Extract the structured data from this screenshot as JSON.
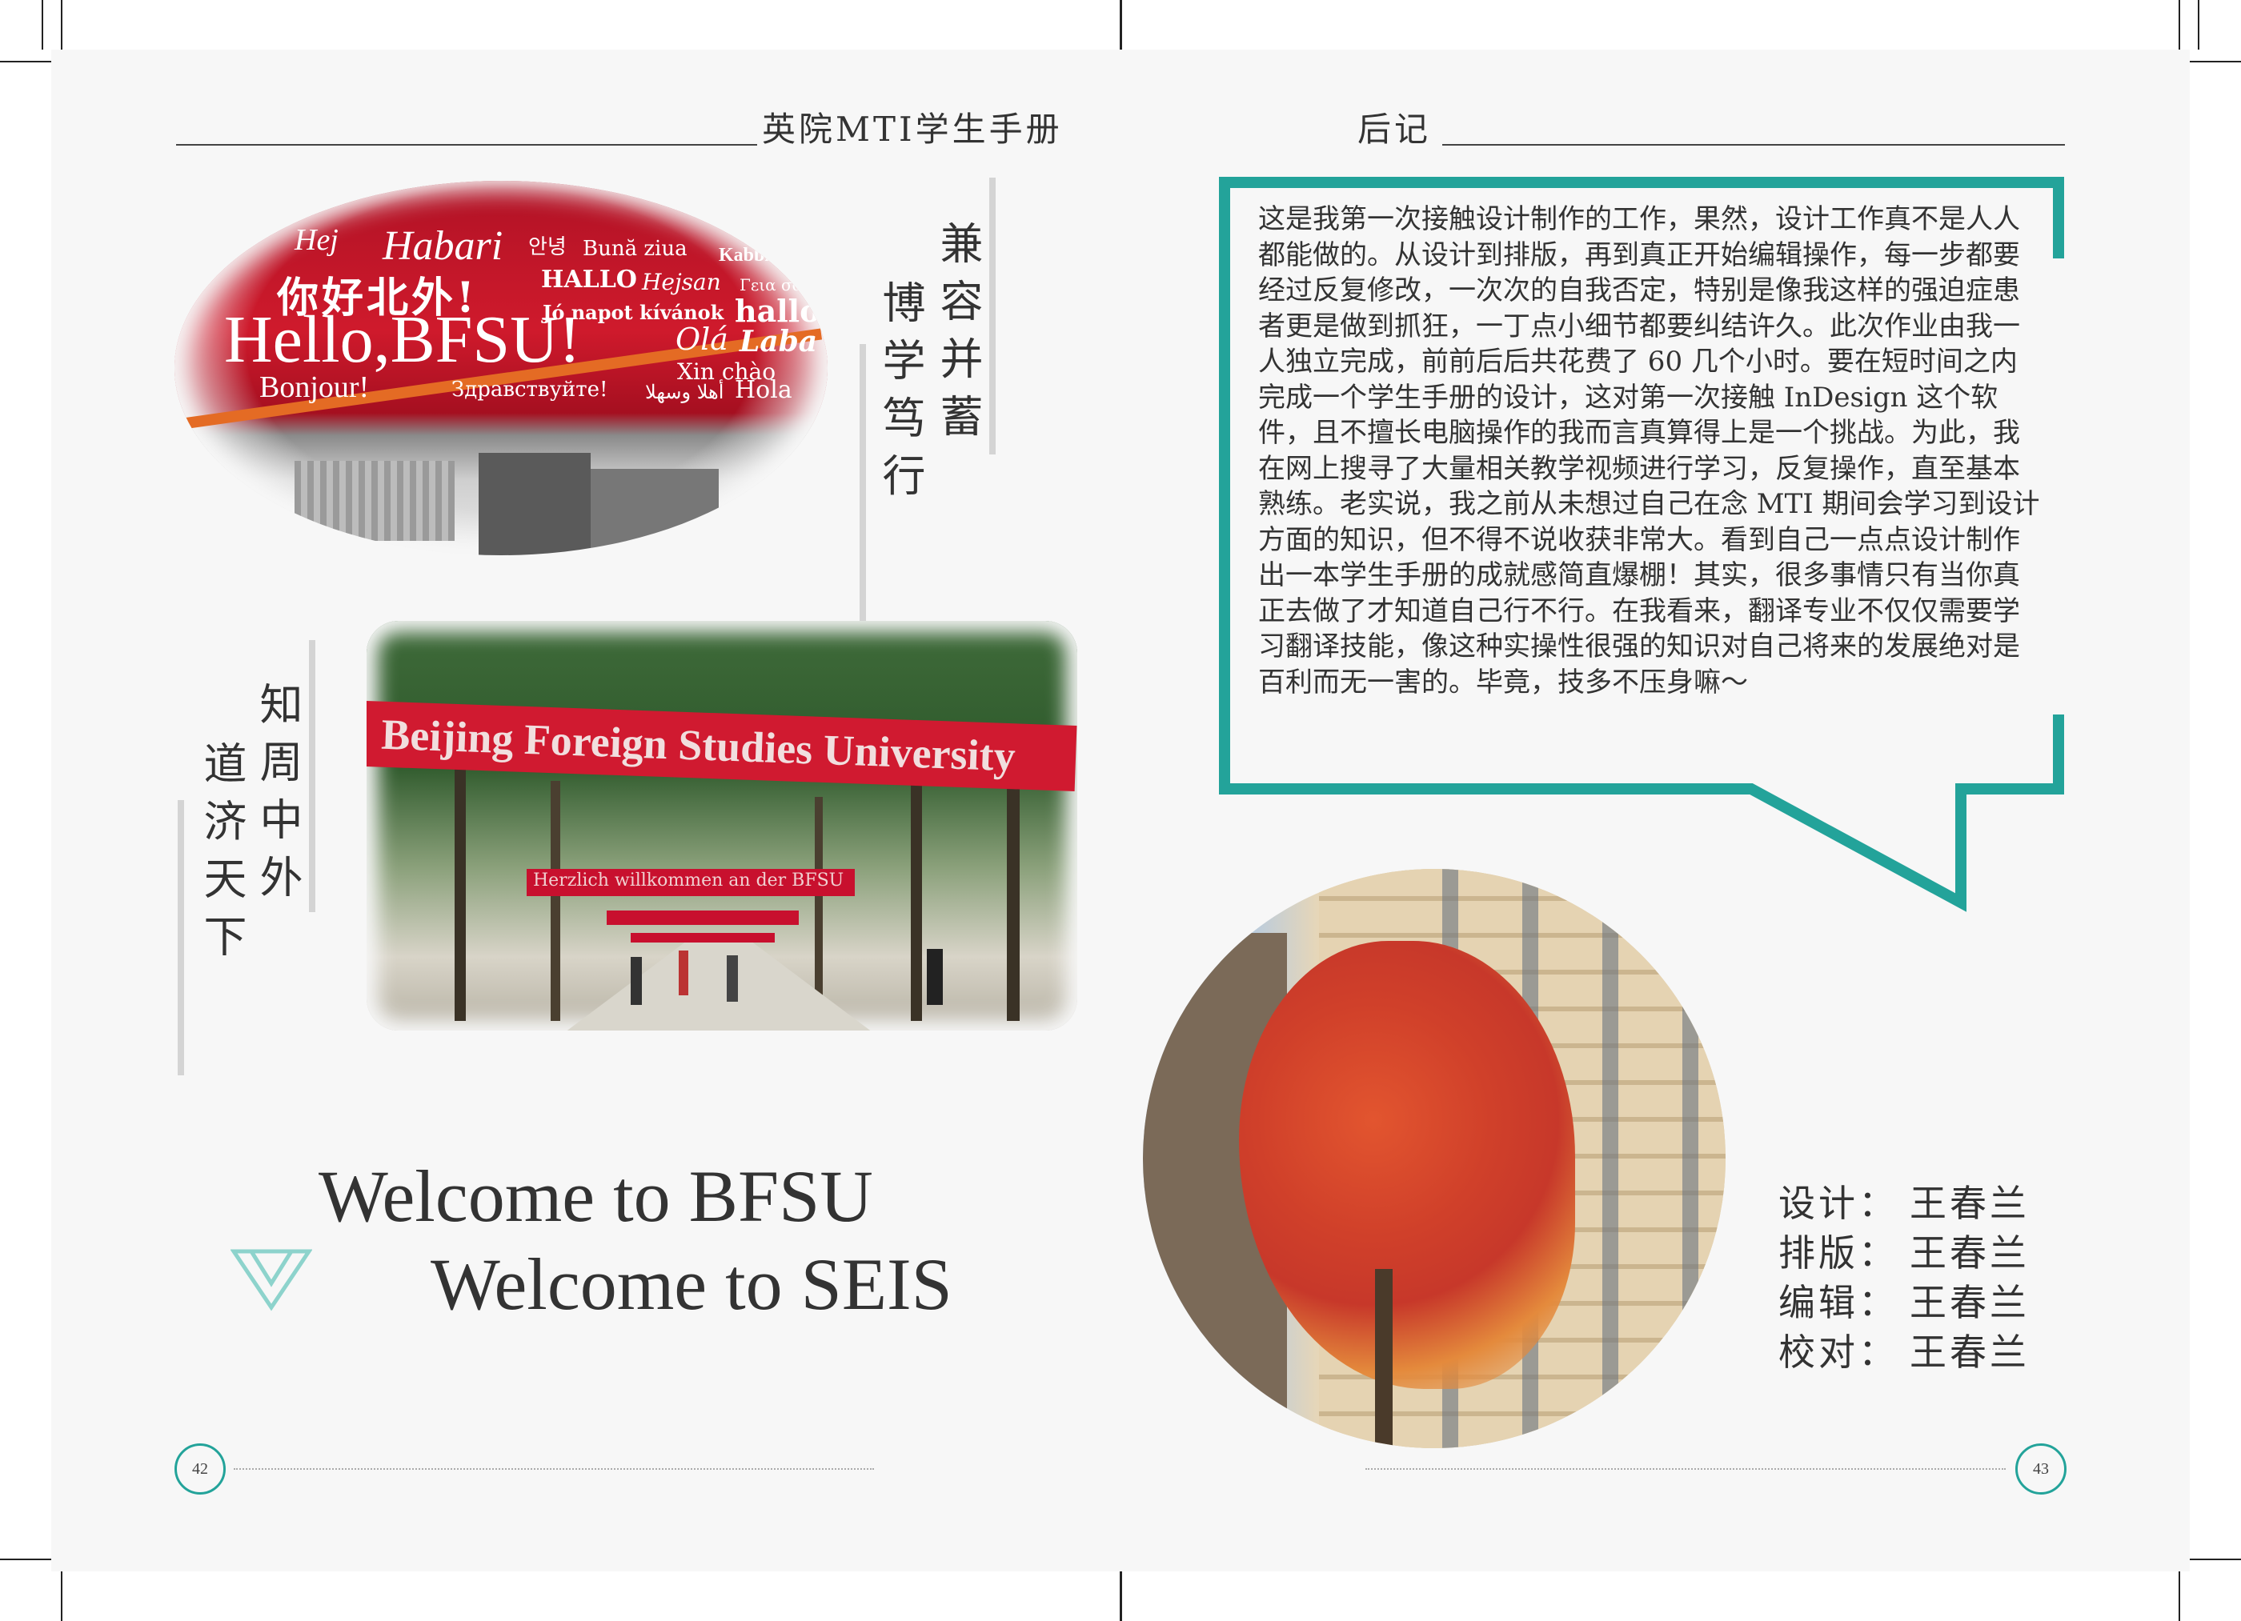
{
  "left_page": {
    "header": "英院MTI学生手册",
    "page_number": "42",
    "motto_1": {
      "col_a": "兼容并蓄",
      "col_b": "博学笃行"
    },
    "motto_2": {
      "col_a": "知周中外",
      "col_b": "道济天下"
    },
    "photo_1": {
      "greetings": [
        "Hej",
        "Habari",
        "안녕",
        "Bună ziua",
        "Kabbieh",
        "你好北外!",
        "HALLO",
        "Hejsan",
        "Γεια σας",
        "Jó napot kívánok",
        "halló",
        "Hello,BFSU!",
        "Olá",
        "Laba",
        "Xin chào",
        "Bonjour!",
        "Здравствуйте!",
        "أهلا وسهلا",
        "Hola"
      ]
    },
    "photo_2": {
      "banner_main": "Beijing Foreign Studies University",
      "banner_small": "Herzlich willkommen an der BFSU"
    },
    "welcome_line_1": "Welcome to BFSU",
    "welcome_line_2": "Welcome to SEIS",
    "triangle_icon": "double-triangle-icon"
  },
  "right_page": {
    "header": "后记",
    "page_number": "43",
    "afterword": "这是我第一次接触设计制作的工作，果然，设计工作真不是人人都能做的。从设计到排版，再到真正开始编辑操作，每一步都要经过反复修改，一次次的自我否定，特别是像我这样的强迫症患者更是做到抓狂，一丁点小细节都要纠结许久。此次作业由我一人独立完成，前前后后共花费了 60 几个小时。要在短时间之内完成一个学生手册的设计，这对第一次接触 InDesign 这个软件，且不擅长电脑操作的我而言真算得上是一个挑战。为此，我在网上搜寻了大量相关教学视频进行学习，反复操作，直至基本熟练。老实说，我之前从未想过自己在念 MTI 期间会学习到设计方面的知识，但不得不说收获非常大。看到自己一点点设计制作出一本学生手册的成就感简直爆棚！其实，很多事情只有当你真正去做了才知道自己行不行。在我看来，翻译专业不仅仅需要学习翻译技能，像这种实操性很强的知识对自己将来的发展绝对是百利而无一害的。毕竟，技多不压身嘛～",
    "credits": [
      {
        "role": "设计：",
        "name": "王春兰"
      },
      {
        "role": "排版：",
        "name": "王春兰"
      },
      {
        "role": "编辑：",
        "name": "王春兰"
      },
      {
        "role": "校对：",
        "name": "王春兰"
      }
    ]
  },
  "colors": {
    "accent_teal": "#23a39a",
    "banner_red": "#c8102e",
    "page_bg": "#f7f7f7"
  }
}
